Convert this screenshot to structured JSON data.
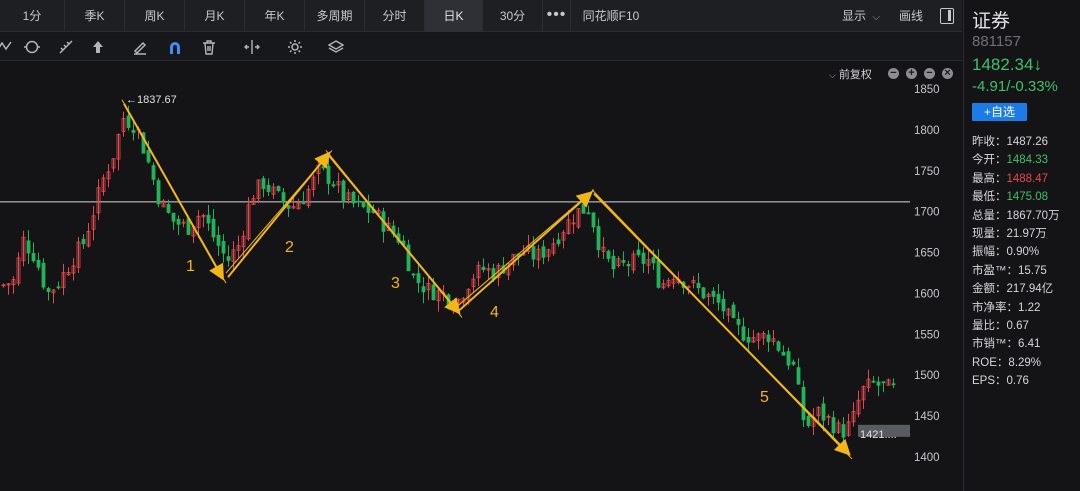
{
  "tabs": [
    {
      "label": "1分",
      "key": "1min"
    },
    {
      "label": "季K",
      "key": "quarter"
    },
    {
      "label": "周K",
      "key": "week"
    },
    {
      "label": "月K",
      "key": "month"
    },
    {
      "label": "年K",
      "key": "year"
    },
    {
      "label": "多周期",
      "key": "multi"
    },
    {
      "label": "分时",
      "key": "intraday"
    },
    {
      "label": "日K",
      "key": "day",
      "active": true
    },
    {
      "label": "30分",
      "key": "30min"
    },
    {
      "label": "•••",
      "key": "more"
    },
    {
      "label": "同花顺F10",
      "key": "f10"
    }
  ],
  "header_right": {
    "display_label": "显示",
    "draw_label": "画线"
  },
  "toolbar_icons": [
    "wave-tool-icon",
    "cycle-tool-icon",
    "ruler-tool-icon",
    "arrow-up-tool-icon",
    "pen-tool-icon",
    "magnet-tool-icon",
    "trash-icon",
    "split-view-icon",
    "settings-icon",
    "layers-icon"
  ],
  "chart_header": {
    "adjust_label": "前复权"
  },
  "chart_data": {
    "type": "candlestick",
    "ylim": [
      1400,
      1850
    ],
    "y_ticks": [
      1850,
      1800,
      1750,
      1700,
      1650,
      1600,
      1550,
      1500,
      1450,
      1400
    ],
    "y_tick_labels": [
      "1850",
      "1800",
      "1750",
      "1700",
      "1650",
      "1600",
      "1550",
      "1500",
      "1450",
      "1400"
    ],
    "horizontal_line": 1712,
    "high_annotation": {
      "text": "←1837.67",
      "value": 1837.67
    },
    "low_annotation": {
      "text": "1421....",
      "value": 1421
    },
    "colors": {
      "up": "#e5484d",
      "down": "#22b35b",
      "trend": "#f3b618",
      "guide": "#d8d8dc"
    },
    "waves": [
      {
        "label": "1",
        "from": 1832,
        "to": 1620
      },
      {
        "label": "2",
        "from": 1620,
        "to": 1770
      },
      {
        "label": "3",
        "from": 1770,
        "to": 1578
      },
      {
        "label": "4",
        "from": 1578,
        "to": 1722
      },
      {
        "label": "5",
        "from": 1722,
        "to": 1405
      }
    ]
  },
  "panel": {
    "name": "证券",
    "code": "881157",
    "price": "1482.34↓",
    "change": "-4.91/-0.33%",
    "watch_label": "+自选",
    "stats": [
      {
        "label": "昨收：",
        "value": "1487.26",
        "tone": "neutral"
      },
      {
        "label": "今开：",
        "value": "1484.33",
        "tone": "down"
      },
      {
        "label": "最高：",
        "value": "1488.47",
        "tone": "up"
      },
      {
        "label": "最低：",
        "value": "1475.08",
        "tone": "down"
      },
      {
        "label": "总量：",
        "value": "1867.70万",
        "tone": "neutral"
      },
      {
        "label": "现量：",
        "value": "21.97万",
        "tone": "neutral"
      },
      {
        "label": "振幅：",
        "value": "0.90%",
        "tone": "neutral"
      },
      {
        "label": "市盈™：",
        "value": "15.75",
        "tone": "neutral"
      },
      {
        "label": "金额：",
        "value": "217.94亿",
        "tone": "neutral"
      },
      {
        "label": "市净率：",
        "value": "1.22",
        "tone": "neutral"
      },
      {
        "label": "量比：",
        "value": "0.67",
        "tone": "neutral"
      },
      {
        "label": "市销™：",
        "value": "6.41",
        "tone": "neutral"
      },
      {
        "label": "ROE：",
        "value": "8.29%",
        "tone": "neutral"
      },
      {
        "label": "EPS：",
        "value": "0.76",
        "tone": "neutral"
      }
    ]
  }
}
